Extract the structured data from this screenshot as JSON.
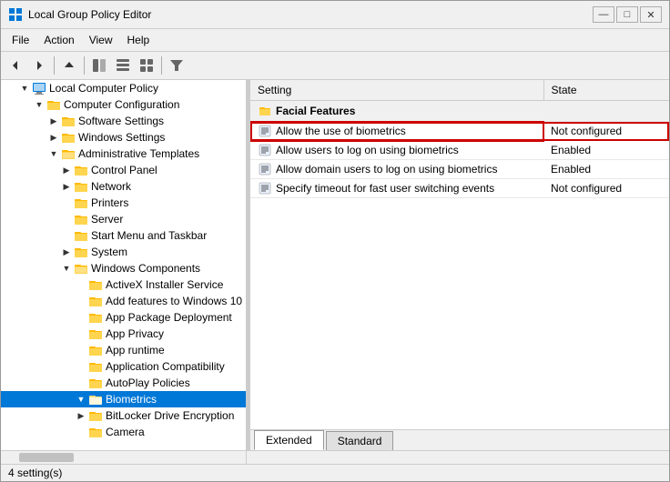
{
  "window": {
    "title": "Local Group Policy Editor",
    "controls": {
      "minimize": "—",
      "maximize": "□",
      "close": "✕"
    }
  },
  "menu": {
    "items": [
      "File",
      "Action",
      "View",
      "Help"
    ]
  },
  "toolbar": {
    "buttons": [
      {
        "name": "back-btn",
        "icon": "◀",
        "label": "Back"
      },
      {
        "name": "forward-btn",
        "icon": "▶",
        "label": "Forward"
      },
      {
        "name": "up-btn",
        "icon": "⬆",
        "label": "Up"
      },
      {
        "name": "show-hide-btn",
        "icon": "🖼",
        "label": "Show/Hide"
      },
      {
        "name": "view1-btn",
        "icon": "▤",
        "label": "View1"
      },
      {
        "name": "view2-btn",
        "icon": "▥",
        "label": "View2"
      },
      {
        "name": "filter-btn",
        "icon": "⬡",
        "label": "Filter"
      }
    ]
  },
  "tree": {
    "items": [
      {
        "id": "local-computer-policy",
        "label": "Local Computer Policy",
        "level": 0,
        "expanded": true,
        "icon": "💻",
        "type": "root"
      },
      {
        "id": "computer-configuration",
        "label": "Computer Configuration",
        "level": 1,
        "expanded": true,
        "icon": "🖥",
        "type": "folder"
      },
      {
        "id": "software-settings",
        "label": "Software Settings",
        "level": 2,
        "expanded": false,
        "icon": "📁",
        "type": "folder"
      },
      {
        "id": "windows-settings",
        "label": "Windows Settings",
        "level": 2,
        "expanded": false,
        "icon": "📁",
        "type": "folder"
      },
      {
        "id": "administrative-templates",
        "label": "Administrative Templates",
        "level": 2,
        "expanded": true,
        "icon": "📂",
        "type": "folder"
      },
      {
        "id": "control-panel",
        "label": "Control Panel",
        "level": 3,
        "expanded": false,
        "icon": "📁",
        "type": "folder"
      },
      {
        "id": "network",
        "label": "Network",
        "level": 3,
        "expanded": false,
        "icon": "📁",
        "type": "folder"
      },
      {
        "id": "printers",
        "label": "Printers",
        "level": 3,
        "expanded": false,
        "icon": "📁",
        "type": "folder"
      },
      {
        "id": "server",
        "label": "Server",
        "level": 3,
        "expanded": false,
        "icon": "📁",
        "type": "folder"
      },
      {
        "id": "start-menu-taskbar",
        "label": "Start Menu and Taskbar",
        "level": 3,
        "expanded": false,
        "icon": "📁",
        "type": "folder"
      },
      {
        "id": "system",
        "label": "System",
        "level": 3,
        "expanded": false,
        "icon": "📁",
        "type": "folder"
      },
      {
        "id": "windows-components",
        "label": "Windows Components",
        "level": 3,
        "expanded": true,
        "icon": "📂",
        "type": "folder"
      },
      {
        "id": "activex-installer",
        "label": "ActiveX Installer Service",
        "level": 4,
        "expanded": false,
        "icon": "📁",
        "type": "folder"
      },
      {
        "id": "add-features",
        "label": "Add features to Windows 10",
        "level": 4,
        "expanded": false,
        "icon": "📁",
        "type": "folder"
      },
      {
        "id": "app-package",
        "label": "App Package Deployment",
        "level": 4,
        "expanded": false,
        "icon": "📁",
        "type": "folder"
      },
      {
        "id": "app-privacy",
        "label": "App Privacy",
        "level": 4,
        "expanded": false,
        "icon": "📁",
        "type": "folder"
      },
      {
        "id": "app-runtime",
        "label": "App runtime",
        "level": 4,
        "expanded": false,
        "icon": "📁",
        "type": "folder"
      },
      {
        "id": "application-compatibility",
        "label": "Application Compatibility",
        "level": 4,
        "expanded": false,
        "icon": "📁",
        "type": "folder"
      },
      {
        "id": "autoplay-policies",
        "label": "AutoPlay Policies",
        "level": 4,
        "expanded": false,
        "icon": "📁",
        "type": "folder"
      },
      {
        "id": "biometrics",
        "label": "Biometrics",
        "level": 4,
        "expanded": true,
        "icon": "📂",
        "type": "folder",
        "selected": true
      },
      {
        "id": "bitlocker",
        "label": "BitLocker Drive Encryption",
        "level": 4,
        "expanded": false,
        "icon": "📁",
        "type": "folder"
      },
      {
        "id": "camera",
        "label": "Camera",
        "level": 4,
        "expanded": false,
        "icon": "📁",
        "type": "folder"
      }
    ]
  },
  "table": {
    "columns": [
      {
        "label": "Setting",
        "width": "70%"
      },
      {
        "label": "State",
        "width": "30%"
      }
    ],
    "section_header": "Facial Features",
    "rows": [
      {
        "id": "row1",
        "setting": "Allow the use of biometrics",
        "state": "Not configured",
        "highlighted": true
      },
      {
        "id": "row2",
        "setting": "Allow users to log on using biometrics",
        "state": "Enabled",
        "highlighted": false
      },
      {
        "id": "row3",
        "setting": "Allow domain users to log on using biometrics",
        "state": "Enabled",
        "highlighted": false
      },
      {
        "id": "row4",
        "setting": "Specify timeout for fast user switching events",
        "state": "Not configured",
        "highlighted": false
      }
    ]
  },
  "tabs": [
    {
      "label": "Extended",
      "active": true
    },
    {
      "label": "Standard",
      "active": false
    }
  ],
  "status_bar": {
    "text": "4 setting(s)"
  },
  "icons": {
    "folder_closed": "🗁",
    "folder_open": "🗂",
    "policy_setting": "≡",
    "computer": "🖥",
    "root": "💻"
  }
}
